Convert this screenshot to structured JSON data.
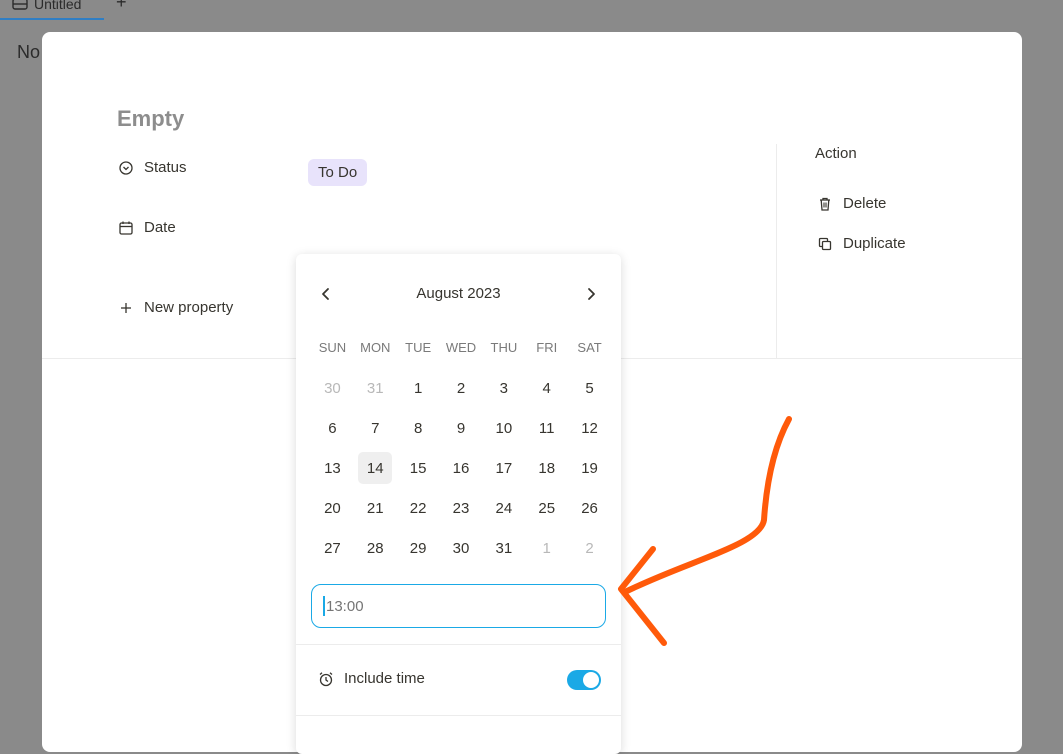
{
  "background": {
    "tab_label": "Untitled",
    "plus": "+",
    "partial_text": "No"
  },
  "page": {
    "title": "Empty",
    "properties": [
      {
        "label": "Status",
        "icon": "status-icon"
      },
      {
        "label": "Date",
        "icon": "calendar-icon"
      }
    ],
    "status_value": "To Do",
    "new_property_label": "New property"
  },
  "actions": {
    "title": "Action",
    "items": [
      {
        "label": "Delete",
        "icon": "trash-icon"
      },
      {
        "label": "Duplicate",
        "icon": "duplicate-icon"
      }
    ]
  },
  "calendar": {
    "month_label": "August 2023",
    "weekdays": [
      "SUN",
      "MON",
      "TUE",
      "WED",
      "THU",
      "FRI",
      "SAT"
    ],
    "days": [
      {
        "d": "30",
        "muted": true
      },
      {
        "d": "31",
        "muted": true
      },
      {
        "d": "1"
      },
      {
        "d": "2"
      },
      {
        "d": "3"
      },
      {
        "d": "4"
      },
      {
        "d": "5"
      },
      {
        "d": "6"
      },
      {
        "d": "7"
      },
      {
        "d": "8"
      },
      {
        "d": "9"
      },
      {
        "d": "10"
      },
      {
        "d": "11"
      },
      {
        "d": "12"
      },
      {
        "d": "13"
      },
      {
        "d": "14",
        "today": true
      },
      {
        "d": "15"
      },
      {
        "d": "16"
      },
      {
        "d": "17"
      },
      {
        "d": "18"
      },
      {
        "d": "19"
      },
      {
        "d": "20"
      },
      {
        "d": "21"
      },
      {
        "d": "22"
      },
      {
        "d": "23"
      },
      {
        "d": "24"
      },
      {
        "d": "25"
      },
      {
        "d": "26"
      },
      {
        "d": "27"
      },
      {
        "d": "28"
      },
      {
        "d": "29"
      },
      {
        "d": "30"
      },
      {
        "d": "31"
      },
      {
        "d": "1",
        "muted": true
      },
      {
        "d": "2",
        "muted": true
      }
    ],
    "time_placeholder": "13:00",
    "include_time_label": "Include time",
    "include_time_on": true
  },
  "colors": {
    "accent": "#1aa9e6",
    "status_pill": "#e8e3fb",
    "annotation": "#ff5a0a"
  }
}
